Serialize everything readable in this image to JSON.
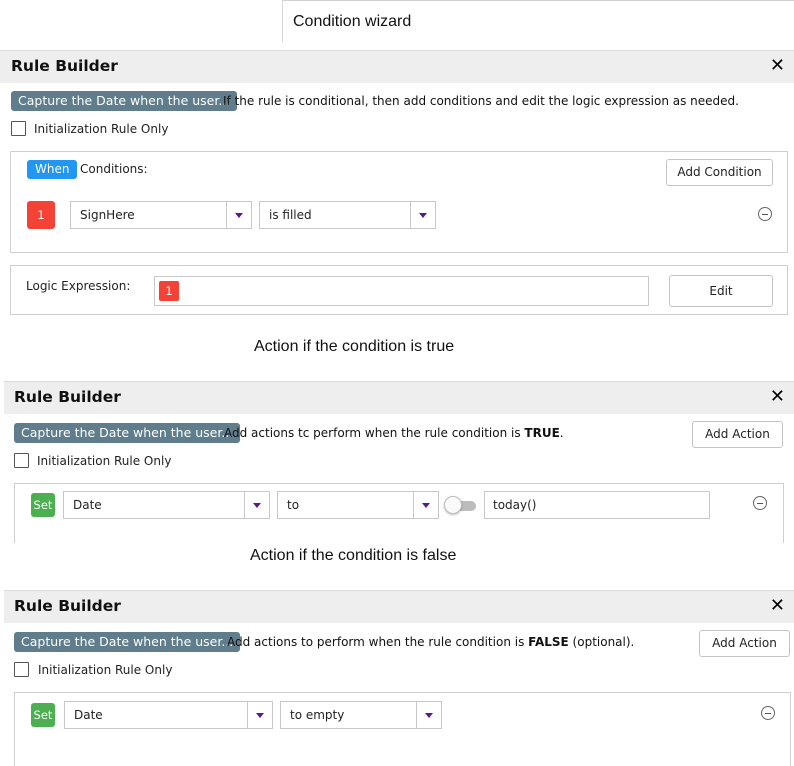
{
  "wizard": {
    "title": "Condition wizard"
  },
  "conditions_section": {
    "header": {
      "title": "Rule Builder"
    },
    "rule_name_pill": "Capture the Date when the user...",
    "description": "If the rule is conditional, then add conditions and edit the logic expression as needed.",
    "init_checkbox": {
      "label": "Initialization Rule Only",
      "checked": false
    },
    "when_badge": "When",
    "conditions_label": "Conditions:",
    "add_condition_label": "Add Condition",
    "condition_row": {
      "number": "1",
      "field": "SignHere",
      "operator": "is filled"
    },
    "logic": {
      "label": "Logic Expression:",
      "token": "1",
      "edit_label": "Edit"
    }
  },
  "true_caption": "Action if the condition is true",
  "true_section": {
    "header": {
      "title": "Rule Builder"
    },
    "rule_name_pill": "Capture the Date when the user...",
    "description_before": "Add actions tc perform when the rule condition is ",
    "description_bold": "TRUE",
    "description_after": ".",
    "add_action_label": "Add Action",
    "init_checkbox": {
      "label": "Initialization Rule Only",
      "checked": false
    },
    "action_row": {
      "badge": "Set",
      "field": "Date",
      "operator": "to",
      "value": "today()",
      "toggle_on": false
    }
  },
  "false_caption": "Action if the condition is false",
  "false_section": {
    "header": {
      "title": "Rule Builder"
    },
    "rule_name_pill": "Capture the Date when the user...",
    "description_before": "Add actions to perform when the rule condition is ",
    "description_bold": "FALSE",
    "description_after": " (optional).",
    "add_action_label": "Add Action",
    "init_checkbox": {
      "label": "Initialization Rule Only",
      "checked": false
    },
    "action_row": {
      "badge": "Set",
      "field": "Date",
      "operator": "to empty"
    }
  },
  "icons": {
    "close": "close-icon",
    "remove": "remove-circle-icon",
    "dropdown": "chevron-down-icon"
  },
  "colors": {
    "pill": "#5f7d8c",
    "when": "#2196f3",
    "set": "#4caf50",
    "number": "#f44336",
    "dropdown_arrow": "#5a1a87",
    "header_bg": "#eeeeee"
  }
}
